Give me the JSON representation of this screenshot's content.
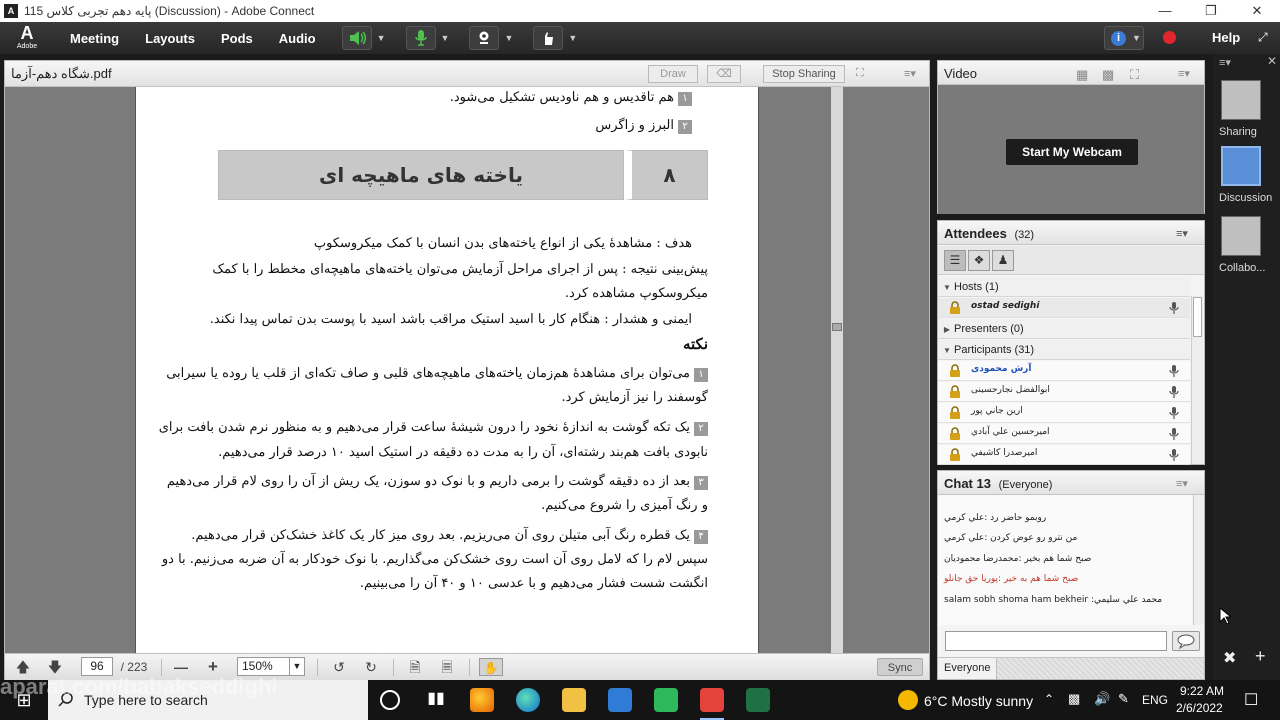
{
  "window": {
    "title": "115 پایه دهم تجربی کلاس (Discussion) - Adobe Connect",
    "app_icon": "adobe-connect-icon",
    "controls": [
      "minimize",
      "maximize",
      "close"
    ]
  },
  "menubar": {
    "logo_text": "A",
    "logo_sub": "Adobe",
    "items": [
      "Meeting",
      "Layouts",
      "Pods",
      "Audio"
    ],
    "help": "Help"
  },
  "share_pod": {
    "title": "شگاه دهم-آزما.pdf",
    "draw": "Draw",
    "stop_sharing": "Stop Sharing",
    "toolbar": {
      "page_input": "96",
      "page_total": "/ 223",
      "zoom": "150%",
      "sync": "Sync"
    }
  },
  "document": {
    "line1": "هم تاقدیس و هم ناودیس تشکیل می‌شود.",
    "line1_num": "۱",
    "line2": "البرز و زاگرس",
    "line2_num": "۲",
    "section_number": "۸",
    "section_title": "یاخته های ماهیچه ای",
    "goal": "هدف : مشاهدهٔ یکی از انواع یاخته‌های بدن انسان با کمک میکروسکوپ",
    "prediction_1": "پیش‌بینی نتیجه : پس از اجرای مراحل آزمایش می‌توان یاخته‌های ماهیچه‌ای مخطط را با کمک",
    "prediction_2": "میکروسکوپ مشاهده کرد.",
    "safety": "ایمنی و هشدار : هنگام کار با اسید استیک مراقب باشد اسید با پوست بدن تماس پیدا نکند.",
    "note_heading": "نکته",
    "note1_a": "می‌توان برای مشاهدهٔ هم‌زمان یاخته‌های ماهیچه‌های قلبی و صاف تکه‌ای از قلب یا روده یا سیرابی",
    "note1_b": "گوسفند را نیز آزمایش کرد.",
    "note1_num": "۱",
    "note2_a": "یک تکه گوشت به اندازهٔ نخود را درون شیشهٔ ساعت قرار می‌دهیم و به منظور نرم شدن بافت برای",
    "note2_b": "نابودی بافت هم‌بند رشته‌ای، آن را به مدت ده دقیقه در استیک اسید ۱۰ درصد قرار می‌دهیم.",
    "note2_num": "۲",
    "note3_a": "بعد از ده دقیقه گوشت را برمی داریم و با نوک دو سوزن، یک ریش از آن را روی لام قرار می‌دهیم",
    "note3_b": "و رنگ آمیزی را شروع می‌کنیم.",
    "note3_num": "۳",
    "note4_a": "یک قطره رنگ آبی متیلن روی آن می‌ریزیم. بعد روی میز کار یک کاغذ خشک‌کن قرار می‌دهیم.",
    "note4_b": "سپس لام را که لامل روی آن است روی خشک‌کن می‌گذاریم. با نوک خودکار به آن ضربه می‌زنیم. با دو",
    "note4_c": "انگشت شست فشار می‌دهیم و با عدسی ۱۰ و ۴۰ آن را می‌بینیم.",
    "note4_num": "۴"
  },
  "video_pod": {
    "title": "Video",
    "start_webcam": "Start My Webcam"
  },
  "attendees_pod": {
    "title": "Attendees",
    "count": "(32)",
    "hosts_label": "Hosts (1)",
    "presenters_label": "Presenters (0)",
    "participants_label": "Participants (31)",
    "hosts": [
      "ostad sedighi"
    ],
    "participants": [
      "آرش محمودی",
      "ابوالفضل نجارحسینی",
      "ارين جاني پور",
      "اميرحسين علي آبادي",
      "اميرصدرا کاشيفي"
    ]
  },
  "chat_pod": {
    "title": "Chat",
    "count": "13",
    "audience": "(Everyone)",
    "messages": [
      {
        "text": "روبمو حاضر رد :علي کرمي",
        "color": "#222222"
      },
      {
        "text": "من نترو رو عوض کردن :علي کرمي",
        "color": "#222222"
      },
      {
        "text": "صبح شما هم بخير :محمدرضا محموديان",
        "color": "#222222"
      },
      {
        "text": "صبح شما هم به خير :پوريا حق جانلو",
        "color": "#c0392b"
      },
      {
        "text": "salam sobh shoma ham bekheir :محمد علي سليمي",
        "color": "#222222"
      }
    ],
    "footer_to": "Everyone"
  },
  "layouts": [
    {
      "label": "Sharing",
      "selected": false
    },
    {
      "label": "Discussion",
      "selected": true
    },
    {
      "label": "Collabo...",
      "selected": false
    }
  ],
  "taskbar": {
    "search_placeholder": "Type here to search",
    "weather": "6°C  Mostly sunny",
    "language": "ENG",
    "time": "9:22 AM",
    "date": "2/6/2022",
    "watermark": "aparat.com/babakseddighi"
  },
  "colors": {
    "record": "#e0262c",
    "chat_highlight": "#c0392b",
    "layout_selected": "#5a8fd8"
  }
}
